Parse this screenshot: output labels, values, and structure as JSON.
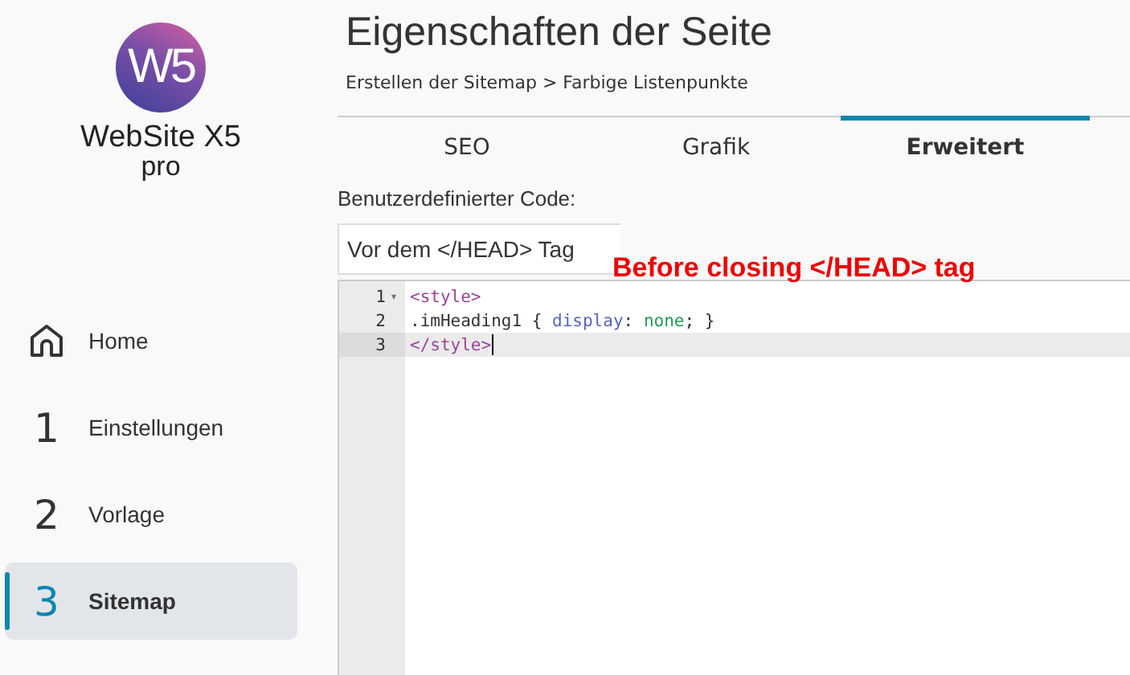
{
  "logo": {
    "mark": "W5",
    "name": "WebSite X5",
    "edition": "pro"
  },
  "sidebar": {
    "items": [
      {
        "kind": "home",
        "label": "Home",
        "selected": false
      },
      {
        "kind": "step",
        "number": "1",
        "label": "Einstellungen",
        "selected": false
      },
      {
        "kind": "step",
        "number": "2",
        "label": "Vorlage",
        "selected": false
      },
      {
        "kind": "step",
        "number": "3",
        "label": "Sitemap",
        "selected": true
      }
    ]
  },
  "page": {
    "title": "Eigenschaften der Seite",
    "breadcrumb": "Erstellen der Sitemap > Farbige Listenpunkte"
  },
  "tabs": [
    {
      "label": "SEO",
      "selected": false
    },
    {
      "label": "Grafik",
      "selected": false
    },
    {
      "label": "Erweitert",
      "selected": true
    }
  ],
  "custom_code": {
    "label": "Benutzerdefinierter Code:",
    "position": {
      "value": "Vor dem </HEAD> Tag"
    },
    "annotation": "Before closing </HEAD> tag",
    "lines": [
      {
        "number": "1",
        "fold": "▾",
        "current": false,
        "tokens": [
          {
            "kind": "tag",
            "text": "<style>"
          }
        ]
      },
      {
        "number": "2",
        "current": false,
        "tokens": [
          {
            "kind": "plain",
            "text": ".imHeading1 { "
          },
          {
            "kind": "property",
            "text": "display"
          },
          {
            "kind": "plain",
            "text": ": "
          },
          {
            "kind": "value",
            "text": "none"
          },
          {
            "kind": "plain",
            "text": "; }"
          }
        ]
      },
      {
        "number": "3",
        "current": true,
        "tokens": [
          {
            "kind": "tag",
            "text": "</style>"
          }
        ]
      }
    ]
  }
}
